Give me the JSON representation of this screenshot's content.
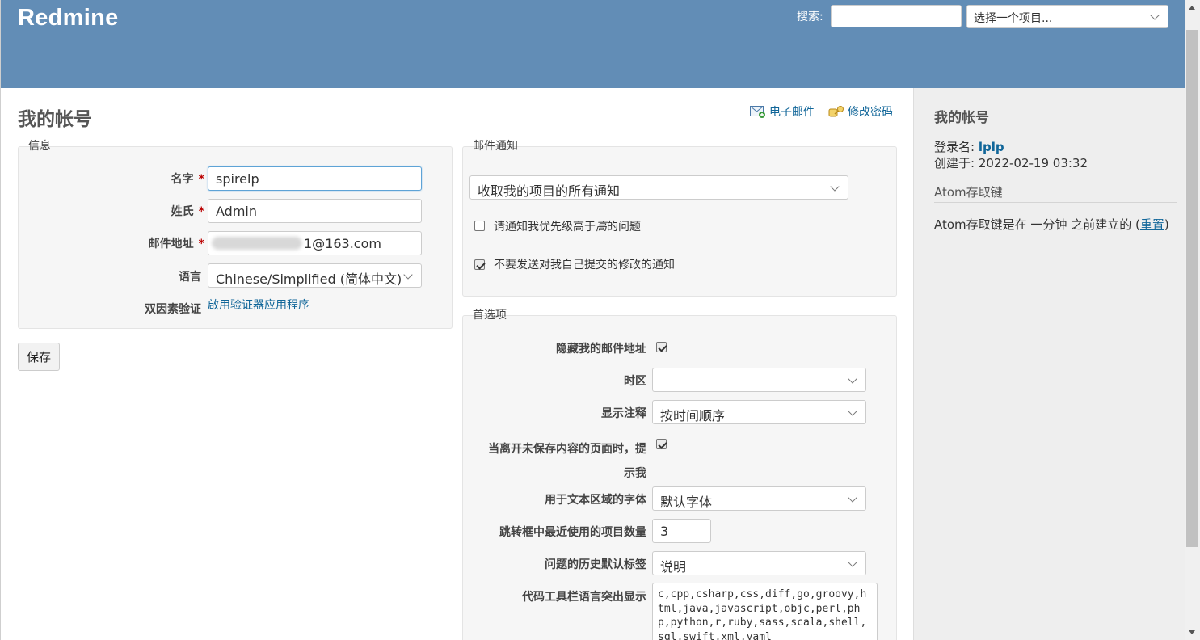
{
  "header": {
    "logo": "Redmine",
    "search_label": "搜索:",
    "search_value": "",
    "project_select": "选择一个项目..."
  },
  "page": {
    "title": "我的帐号",
    "email_link": "电子邮件",
    "password_link": "修改密码"
  },
  "info": {
    "legend": "信息",
    "firstname_label": "名字",
    "firstname_value": "spirelp",
    "lastname_label": "姓氏",
    "lastname_value": "Admin",
    "mail_label": "邮件地址",
    "mail_value": "1@163.com",
    "language_label": "语言",
    "language_value": "Chinese/Simplified (简体中文)",
    "twofa_label": "双因素验证",
    "twofa_link": "啟用验证器应用程序",
    "required_mark": "*"
  },
  "save_button": "保存",
  "mail_notification": {
    "legend": "邮件通知",
    "select_value": "收取我的项目的所有通知",
    "option_high_priority": "请通知我优先级高于",
    "option_high_priority_value": "高",
    "option_high_priority_suffix": "的问题",
    "option_high_priority_checked": false,
    "option_no_self": "不要发送对我自己提交的修改的通知",
    "option_no_self_checked": true
  },
  "preferences": {
    "legend": "首选项",
    "hide_mail_label": "隐藏我的邮件地址",
    "hide_mail_checked": true,
    "timezone_label": "时区",
    "timezone_value": "",
    "comments_order_label": "显示注释",
    "comments_order_value": "按时间顺序",
    "warn_unsaved_label_1": "当离开未保存内容的页面时，提",
    "warn_unsaved_label_2": "示我",
    "warn_unsaved_checked": true,
    "textarea_font_label": "用于文本区域的字体",
    "textarea_font_value": "默认字体",
    "recent_projects_label": "跳转框中最近使用的项目数量",
    "recent_projects_value": "3",
    "history_tab_label": "问题的历史默认标签",
    "history_tab_value": "说明",
    "toolbar_lang_label": "代码工具栏语言突出显示",
    "toolbar_lang_value": "c,cpp,csharp,css,diff,go,groovy,html,java,javascript,objc,perl,php,python,r,ruby,sass,scala,shell,sql,swift,xml,yaml"
  },
  "sidebar": {
    "title": "我的帐号",
    "login_label": "登录名:",
    "login_value": "lplp",
    "created_label": "创建于:",
    "created_value": "2022-02-19 03:32",
    "atom_heading": "Atom存取键",
    "atom_text": "Atom存取键是在 一分钟 之前建立的 (",
    "atom_reset": "重置",
    "atom_close": ")"
  },
  "colors": {
    "header_bg": "#628db6",
    "link": "#116699",
    "required": "#bb0000"
  }
}
